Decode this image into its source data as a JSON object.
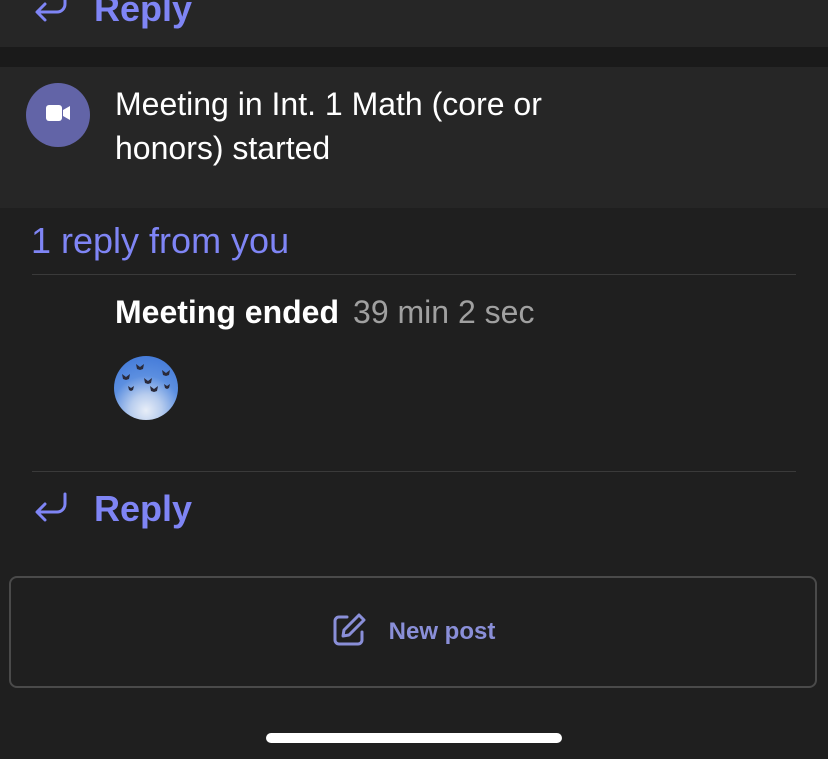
{
  "top_reply": {
    "label": "Reply",
    "icon": "reply-arrow-icon"
  },
  "meeting": {
    "title": "Meeting in Int. 1 Math (core or honors) started",
    "icon": "video-camera-icon"
  },
  "thread": {
    "replies_summary": "1 reply from you",
    "event_label": "Meeting ended",
    "duration": "39 min 2 sec",
    "participant_avatar": "butterfly-sky-avatar"
  },
  "bottom_reply": {
    "label": "Reply",
    "icon": "reply-arrow-icon"
  },
  "new_post": {
    "label": "New post",
    "icon": "compose-icon"
  },
  "colors": {
    "accent": "#7f85f5",
    "meeting_icon_bg": "#6264a7",
    "background": "#1f1f1f",
    "card": "#262626"
  }
}
